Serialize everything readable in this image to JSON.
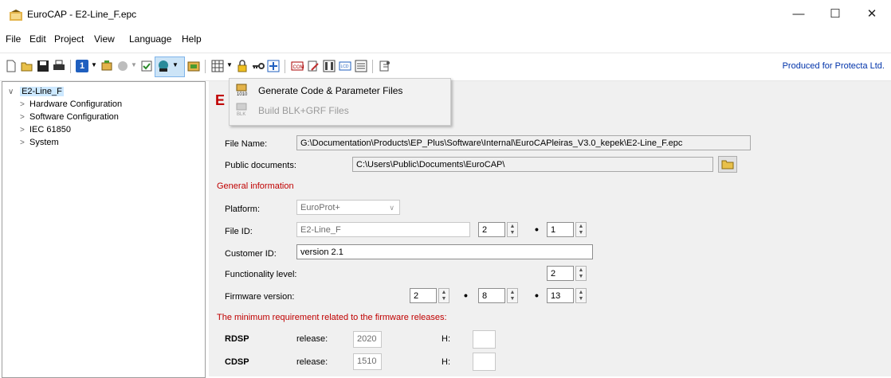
{
  "window": {
    "title": "EuroCAP - E2-Line_F.epc"
  },
  "menu": [
    "File",
    "Edit",
    "Project",
    "View",
    "Language",
    "Help"
  ],
  "toolbar": {
    "produced_for": "Produced for Protecta Ltd.",
    "number_button": "1"
  },
  "dropdown": {
    "items": [
      {
        "label": "Generate Code & Parameter Files",
        "enabled": true
      },
      {
        "label": "Build BLK+GRF Files",
        "enabled": false
      }
    ]
  },
  "tree": {
    "root": "E2-Line_F",
    "children": [
      "Hardware Configuration",
      "Software Configuration",
      "IEC 61850",
      "System"
    ]
  },
  "main": {
    "heading_letter": "E",
    "file_name_label": "File Name:",
    "file_name": "G:\\Documentation\\Products\\EP_Plus\\Software\\Internal\\EuroCAPleiras_V3.0_kepek\\E2-Line_F.epc",
    "public_docs_label": "Public documents:",
    "public_docs": "C:\\Users\\Public\\Documents\\EuroCAP\\",
    "general_info": "General information",
    "platform_label": "Platform:",
    "platform": "EuroProt+",
    "file_id_label": "File ID:",
    "file_id": "E2-Line_F",
    "file_id_major": "2",
    "file_id_minor": "1",
    "customer_id_label": "Customer ID:",
    "customer_id": "version 2.1",
    "functionality_label": "Functionality level:",
    "functionality": "2",
    "firmware_label": "Firmware version:",
    "fw1": "2",
    "fw2": "8",
    "fw3": "13",
    "min_req": "The minimum requirement related to the firmware releases:",
    "rdsp_label": "RDSP",
    "rdsp_release_label": "release:",
    "rdsp_release": "2020",
    "rdsp_h_label": "H:",
    "rdsp_h": "",
    "cdsp_label": "CDSP",
    "cdsp_release_label": "release:",
    "cdsp_release": "1510",
    "cdsp_h_label": "H:",
    "cdsp_h": ""
  },
  "colors": {
    "accent_red": "#c00000",
    "link_blue": "#0033aa",
    "panel_bg": "#f0f0f0"
  }
}
